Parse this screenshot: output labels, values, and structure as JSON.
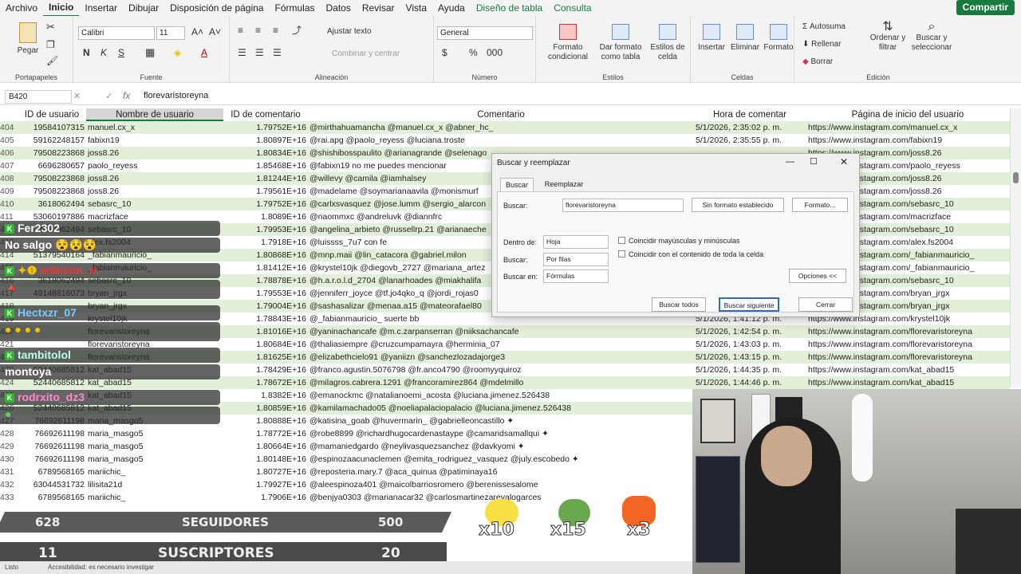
{
  "menu": {
    "items": [
      "Archivo",
      "Inicio",
      "Insertar",
      "Dibujar",
      "Disposición de página",
      "Fórmulas",
      "Datos",
      "Revisar",
      "Vista",
      "Ayuda",
      "Diseño de tabla",
      "Consulta"
    ],
    "share": "Compartir"
  },
  "ribbon": {
    "paste": "Pegar",
    "clipboard": "Portapapeles",
    "font_name": "Calibri",
    "font_size": "11",
    "font_group": "Fuente",
    "wrap": "Ajustar texto",
    "merge": "Combinar y centrar",
    "align_group": "Alineación",
    "num_format": "General",
    "num_group": "Número",
    "cond_format": "Formato condicional",
    "table_format": "Dar formato como tabla",
    "cell_styles": "Estilos de celda",
    "styles_group": "Estilos",
    "insert": "Insertar",
    "delete": "Eliminar",
    "format": "Formato",
    "cells_group": "Celdas",
    "autosum": "Autosuma",
    "fill": "Rellenar",
    "clear": "Borrar",
    "sort": "Ordenar y filtrar",
    "find": "Buscar y seleccionar",
    "edit_group": "Edición"
  },
  "formula": {
    "namebox": "B420",
    "fx": "fx",
    "value": "florevaristoreyna"
  },
  "headers": [
    "ID de usuario",
    "Nombre de usuario",
    "ID de comentario",
    "Comentario",
    "Hora de comentar",
    "Página de inicio del usuario"
  ],
  "rows": [
    {
      "n": "404",
      "id": "19584107315",
      "user": "manuel.cx_x",
      "cid": "1.79752E+16",
      "comment": "@mirthahuamancha @manuel.cx_x @abner_hc_",
      "time": "5/1/2026, 2:35:02 p. m.",
      "url": "https://www.instagram.com/manuel.cx_x",
      "g": true
    },
    {
      "n": "405",
      "id": "59162248157",
      "user": "fabixn19",
      "cid": "1.80897E+16",
      "comment": "@rai.apg @paolo_reyess @luciana.troste",
      "time": "5/1/2026, 2:35:55 p. m.",
      "url": "https://www.instagram.com/fabixn19",
      "g": false
    },
    {
      "n": "406",
      "id": "79508223868",
      "user": "joss8.26",
      "cid": "1.80834E+16",
      "comment": "@shishibosspaulito @arianagrande @selenago",
      "time": "",
      "url": "https://www.instagram.com/joss8.26",
      "g": true
    },
    {
      "n": "407",
      "id": "6696280657",
      "user": "paolo_reyess",
      "cid": "1.85468E+16",
      "comment": "@fabixn19 no me puedes mencionar",
      "time": "",
      "url": "https://www.instagram.com/paolo_reyess",
      "g": false
    },
    {
      "n": "408",
      "id": "79508223868",
      "user": "joss8.26",
      "cid": "1.81244E+16",
      "comment": "@willevy @camila @iamhalsey",
      "time": "",
      "url": "https://www.instagram.com/joss8.26",
      "g": true
    },
    {
      "n": "409",
      "id": "79508223868",
      "user": "joss8.26",
      "cid": "1.79561E+16",
      "comment": "@madelame @soymarianaavila @monismurf",
      "time": "",
      "url": "https://www.instagram.com/joss8.26",
      "g": false
    },
    {
      "n": "410",
      "id": "3618062494",
      "user": "sebasrc_10",
      "cid": "1.79752E+16",
      "comment": "@carlxsvasquez @jose.lumm @sergio_alarcon",
      "time": "",
      "url": "https://www.instagram.com/sebasrc_10",
      "g": true
    },
    {
      "n": "411",
      "id": "53060197886",
      "user": "macrizface",
      "cid": "1.8089E+16",
      "comment": "@naommxc @andreluvk @diannfrc",
      "time": "",
      "url": "https://www.instagram.com/macrizface",
      "g": false
    },
    {
      "n": "412",
      "id": "3618062494",
      "user": "sebasrc_10",
      "cid": "1.79953E+16",
      "comment": "@angelina_arbieto @russellrp.21 @arianaeche",
      "time": "",
      "url": "https://www.instagram.com/sebasrc_10",
      "g": true
    },
    {
      "n": "413",
      "id": "",
      "user": "alex.fs2004",
      "cid": "1.7918E+16",
      "comment": "@luissss_7u7 con fe",
      "time": "",
      "url": "https://www.instagram.com/alex.fs2004",
      "g": false
    },
    {
      "n": "414",
      "id": "51379540164",
      "user": "_fabianmauricio_",
      "cid": "1.80868E+16",
      "comment": "@mnp.maii @lin_catacora @gabriel.milon",
      "time": "",
      "url": "https://www.instagram.com/_fabianmauricio_",
      "g": true
    },
    {
      "n": "415",
      "id": "",
      "user": "_fabianmauricio_",
      "cid": "1.81412E+16",
      "comment": "@krystel10jk @diegovb_2727 @mariana_artez",
      "time": "",
      "url": "https://www.instagram.com/_fabianmauricio_",
      "g": false
    },
    {
      "n": "416",
      "id": "3618062494",
      "user": "sebasrc_10",
      "cid": "1.78878E+16",
      "comment": "@h.a.r.o.l.d_2704 @lanarhoades @miakhalifa",
      "time": "",
      "url": "https://www.instagram.com/sebasrc_10",
      "g": true
    },
    {
      "n": "417",
      "id": "49148816073",
      "user": "bryan_jrgx",
      "cid": "1.79553E+16",
      "comment": "@jenniferr_joyce @tf.jo4qko_q @jordi_rojas0",
      "time": "",
      "url": "https://www.instagram.com/bryan_jrgx",
      "g": false
    },
    {
      "n": "418",
      "id": "",
      "user": "bryan_jrgx",
      "cid": "1.79004E+16",
      "comment": "@sashasalizar @menaa.a15 @mateorafael80",
      "time": "",
      "url": "https://www.instagram.com/bryan_jrgx",
      "g": true
    },
    {
      "n": "419",
      "id": "",
      "user": "krystel10jk",
      "cid": "1.78843E+16",
      "comment": "@_fabianmauricio_ suerte bb",
      "time": "5/1/2026, 1:41:12 p. m.",
      "url": "https://www.instagram.com/krystel10jk",
      "g": false
    },
    {
      "n": "420",
      "id": "",
      "user": "florevaristoreyna",
      "cid": "1.81016E+16",
      "comment": "@yaninachancafe @m.c.zarpanserran @niiksachancafe",
      "time": "5/1/2026, 1:42:54 p. m.",
      "url": "https://www.instagram.com/florevaristoreyna",
      "g": true
    },
    {
      "n": "421",
      "id": "",
      "user": "florevaristoreyna",
      "cid": "1.80684E+16",
      "comment": "@thaliasiempre @cruzcumpamayra @herminia_07",
      "time": "5/1/2026, 1:43:03 p. m.",
      "url": "https://www.instagram.com/florevaristoreyna",
      "g": false
    },
    {
      "n": "422",
      "id": "",
      "user": "florevaristoreyna",
      "cid": "1.81625E+16",
      "comment": "@elizabethcielo91 @yaniizn @sanchezlozadajorge3",
      "time": "5/1/2026, 1:43:15 p. m.",
      "url": "https://www.instagram.com/florevaristoreyna",
      "g": true
    },
    {
      "n": "423",
      "id": "52440685812",
      "user": "kat_abad15",
      "cid": "1.78429E+16",
      "comment": "@franco.agustin.5076798 @fr.anco4790 @roomyyquiroz",
      "time": "5/1/2026, 1:44:35 p. m.",
      "url": "https://www.instagram.com/kat_abad15",
      "g": false
    },
    {
      "n": "424",
      "id": "52440685812",
      "user": "kat_abad15",
      "cid": "1.78672E+16",
      "comment": "@milagros.cabrera.1291 @francoramirez864 @mdelmillo",
      "time": "5/1/2026, 1:44:46 p. m.",
      "url": "https://www.instagram.com/kat_abad15",
      "g": true
    },
    {
      "n": "425",
      "id": "",
      "user": "kat_abad15",
      "cid": "1.8382E+16",
      "comment": "@emanockmc @natalianoemi_acosta @luciana.jimenez.526438",
      "time": "",
      "url": "",
      "g": false
    },
    {
      "n": "426",
      "id": "52440685812",
      "user": "kat_abad15",
      "cid": "1.80859E+16",
      "comment": "@kamilamachado05 @noeliapalaciopalacio @luciana.jimenez.526438",
      "time": "",
      "url": "",
      "g": true
    },
    {
      "n": "427",
      "id": "76692611198",
      "user": "maria_masgo5",
      "cid": "1.80888E+16",
      "comment": "@katisina_goab @huvermarin_ @gabrielleoncastillo ✦",
      "time": "",
      "url": "",
      "g": false
    },
    {
      "n": "428",
      "id": "76692611198",
      "user": "maria_masgo5",
      "cid": "1.78772E+16",
      "comment": "@robe8899 @richardhugocardenastaype @camaridsamallqui ✦",
      "time": "",
      "url": "",
      "g": false
    },
    {
      "n": "429",
      "id": "76692611198",
      "user": "maria_masgo5",
      "cid": "1.80664E+16",
      "comment": "@mamaniedgardo @neylivasquezsanchez @davkyomi ✦",
      "time": "",
      "url": "",
      "g": false
    },
    {
      "n": "430",
      "id": "76692611198",
      "user": "maria_masgo5",
      "cid": "1.80148E+16",
      "comment": "@espinozaacunaclemen @emita_rodriguez_vasquez @july.escobedo ✦",
      "time": "",
      "url": "",
      "g": false
    },
    {
      "n": "431",
      "id": "6789568165",
      "user": "mariichic_",
      "cid": "1.80727E+16",
      "comment": "@reposteria.mary.7 @aca_quinua @patiminaya16",
      "time": "",
      "url": "",
      "g": false
    },
    {
      "n": "432",
      "id": "63044531732",
      "user": "lilisita21d",
      "cid": "1.79927E+16",
      "comment": "@aleespinoza401 @maicolbarriosromero @berenissesalome",
      "time": "",
      "url": "",
      "g": false
    },
    {
      "n": "433",
      "id": "6789568165",
      "user": "mariichic_",
      "cid": "1.7906E+16",
      "comment": "@benjya0303 @marianacar32 @carlosmartinezarevalogarces",
      "time": "",
      "url": "",
      "g": false
    }
  ],
  "dialog": {
    "title": "Buscar y reemplazar",
    "tab_find": "Buscar",
    "tab_replace": "Reemplazar",
    "find_label": "Buscar:",
    "find_value": "florevaristoreyna",
    "no_format": "Sin formato establecido",
    "format_btn": "Formato...",
    "within_label": "Dentro de:",
    "within_val": "Hoja",
    "search_label": "Buscar:",
    "search_val": "Por filas",
    "look_label": "Buscar en:",
    "look_val": "Fórmulas",
    "match_case": "Coincidir mayúsculas y minúsculas",
    "match_cell": "Coincidir con el contenido de toda la celda",
    "options": "Opciones <<",
    "find_all": "Buscar todos",
    "find_next": "Buscar siguiente",
    "close": "Cerrar"
  },
  "chat": [
    {
      "user": "Fer2302",
      "msg": ""
    },
    {
      "user": "",
      "msg": "No salgo"
    },
    {
      "user": "edinson_rr",
      "msg": ""
    },
    {
      "user": "",
      "msg": ""
    },
    {
      "user": "Hectxzr_07",
      "msg": ""
    },
    {
      "user": "",
      "msg": ""
    },
    {
      "user": "tambitolol",
      "msg": ""
    },
    {
      "user": "",
      "msg": "montoya"
    },
    {
      "user": "rodrxito_dz3",
      "msg": ""
    }
  ],
  "overlay": {
    "followers_count": "628",
    "followers_label": "SEGUIDORES",
    "followers_goal": "500",
    "subs_count": "11",
    "subs_label": "SUSCRIPTORES",
    "subs_goal": "20",
    "mult1": "x10",
    "mult2": "x15",
    "mult3": "x3"
  },
  "status": {
    "ready": "Listo",
    "access": "Accesibilidad: es necesario investigar"
  },
  "colors": {
    "excel_green": "#1a7a3e",
    "row_green": "#e2efd9"
  }
}
